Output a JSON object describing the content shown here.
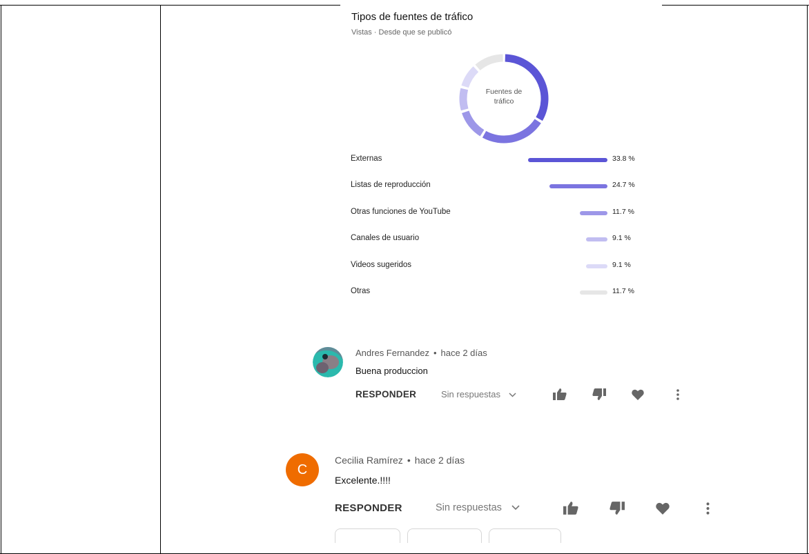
{
  "traffic_card": {
    "title": "Tipos de fuentes de tráfico",
    "subtitle": "Vistas · Desde que se publicó",
    "donut_center_line1": "Fuentes de",
    "donut_center_line2": "tráfico",
    "sources": [
      {
        "label": "Externas",
        "value": "33.8 %",
        "fraction": 0.338,
        "color": "#5b55d6"
      },
      {
        "label": "Listas de reproducción",
        "value": "24.7 %",
        "fraction": 0.247,
        "color": "#7b74e0"
      },
      {
        "label": "Otras funciones de YouTube",
        "value": "11.7 %",
        "fraction": 0.117,
        "color": "#9d97e8"
      },
      {
        "label": "Canales de usuario",
        "value": "9.1 %",
        "fraction": 0.091,
        "color": "#c1bdf1"
      },
      {
        "label": "Videos sugeridos",
        "value": "9.1 %",
        "fraction": 0.091,
        "color": "#dcdaf7"
      },
      {
        "label": "Otras",
        "value": "11.7 %",
        "fraction": 0.117,
        "color": "#e6e6e6"
      }
    ]
  },
  "comments": [
    {
      "author": "Andres Fernandez",
      "separator": "•",
      "time": "hace 2 días",
      "text": "Buena produccion",
      "reply_label": "RESPONDER",
      "replies_label": "Sin respuestas",
      "avatar": "photo"
    },
    {
      "author": "Cecilia Ramírez",
      "separator": "•",
      "time": "hace 2 días",
      "text": "Excelente.!!!!",
      "reply_label": "RESPONDER",
      "replies_label": "Sin respuestas",
      "avatar_letter": "C",
      "avatar_color": "#ef6c00"
    }
  ],
  "icons": [
    "thumb-up-icon",
    "thumb-down-icon",
    "heart-icon",
    "more-vert-icon",
    "chevron-down-icon"
  ]
}
